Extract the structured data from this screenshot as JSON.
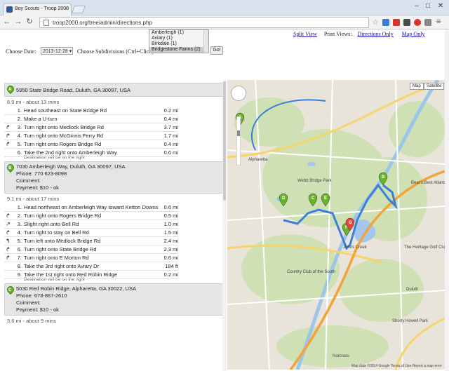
{
  "browser": {
    "tab_title": "Boy Scouts - Troop 2000",
    "url": "troop2000.org/tree/admin/directions.php"
  },
  "links": {
    "split_view": "Split View",
    "print_views": "Print Views:",
    "directions_only": "Directions Only",
    "map_only": "Map Only"
  },
  "controls": {
    "date_label": "Choose Date:",
    "date_value": "2013-12-28",
    "subdiv_label": "Choose Subdivisions (Ctrl+Click):",
    "subdivisions": [
      "Amberleigh (1)",
      "Aviary (1)",
      "Birkdale (1)",
      "Bridgestone Farms (2)"
    ],
    "go_label": "Go!"
  },
  "stops": [
    {
      "pin": "A",
      "address": "5950 State Bridge Road, Duluth, GA 30097, USA"
    },
    {
      "pin": "B",
      "address": "7030 Amberleigh Way, Duluth, GA 30097, USA",
      "phone": "Phone: 770 623-8098",
      "comment": "Comment:",
      "payment": "Payment: $10 - ok"
    },
    {
      "pin": "C",
      "address": "5030 Red Robin Ridge, Alpharetta, GA 30022, USA",
      "phone": "Phone: 678-867-2610",
      "comment": "Comment:",
      "payment": "Payment: $10 - ok"
    }
  ],
  "legs": [
    {
      "summary": "6.9 mi - about 13 mins",
      "steps": [
        {
          "icon": "",
          "num": "1.",
          "text": "Head southeast on State Bridge Rd",
          "dist": "0.2 mi"
        },
        {
          "icon": "",
          "num": "2.",
          "text": "Make a U-turn",
          "dist": "0.4 mi"
        },
        {
          "icon": "turn-right-icon",
          "num": "3.",
          "text": "Turn right onto Medlock Bridge Rd",
          "dist": "3.7 mi"
        },
        {
          "icon": "turn-right-icon",
          "num": "4.",
          "text": "Turn right onto McGinnis Ferry Rd",
          "dist": "1.7 mi"
        },
        {
          "icon": "turn-right-icon",
          "num": "5.",
          "text": "Turn right onto Rogers Bridge Rd",
          "dist": "0.4 mi"
        },
        {
          "icon": "",
          "num": "6.",
          "text": "Take the 2nd right onto Amberleigh Way",
          "dist": "0.6 mi"
        }
      ],
      "note": "Destination will be on the right"
    },
    {
      "summary": "9.1 mi - about 17 mins",
      "steps": [
        {
          "icon": "",
          "num": "1.",
          "text": "Head northeast on Amberleigh Way toward Ketton Downs",
          "dist": "0.6 mi"
        },
        {
          "icon": "turn-right-icon",
          "num": "2.",
          "text": "Turn right onto Rogers Bridge Rd",
          "dist": "0.5 mi"
        },
        {
          "icon": "slight-right-icon",
          "num": "3.",
          "text": "Slight right onto Bell Rd",
          "dist": "1.0 mi"
        },
        {
          "icon": "turn-right-icon",
          "num": "4.",
          "text": "Turn right to stay on Bell Rd",
          "dist": "1.5 mi"
        },
        {
          "icon": "turn-left-icon",
          "num": "5.",
          "text": "Turn left onto Medlock Bridge Rd",
          "dist": "2.4 mi"
        },
        {
          "icon": "turn-right-icon",
          "num": "6.",
          "text": "Turn right onto State Bridge Rd",
          "dist": "2.3 mi"
        },
        {
          "icon": "turn-right-icon",
          "num": "7.",
          "text": "Turn right onto E Morton Rd",
          "dist": "0.6 mi"
        },
        {
          "icon": "",
          "num": "8.",
          "text": "Take the 3rd right onto Aviary Dr",
          "dist": "184 ft"
        },
        {
          "icon": "",
          "num": "9.",
          "text": "Take the 1st right onto Red Robin Ridge",
          "dist": "0.2 mi"
        }
      ],
      "note": "Destination will be on the right"
    }
  ],
  "next_leg_summary": "3.6 mi - about 9 mins",
  "map": {
    "map_btn": "Map",
    "satellite_btn": "Satellite",
    "labels": [
      "Alpharetta",
      "Webb Bridge Park",
      "Country Club of the South",
      "Johns Creek",
      "Duluth",
      "Shorty Howell Park",
      "Norcross",
      "The Heritage Golf Club",
      "Bear's Best Atlanta"
    ],
    "markers": [
      "A",
      "B",
      "C",
      "D",
      "E",
      "F",
      "G"
    ],
    "attribution": "Map data ©2014 Google   Terms of Use   Report a map error",
    "route_color": "#3b7fd9",
    "marker_color": "#6bb32c",
    "end_marker_color": "#e8463a"
  }
}
